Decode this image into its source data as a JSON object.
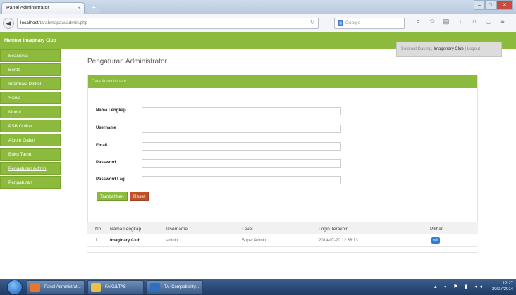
{
  "browser": {
    "tab_title": "Panel Administrator",
    "tab_close": "×",
    "new_tab": "+",
    "url_host": "localhost",
    "url_path": "/tarahmapaw/admin.php",
    "search_placeholder": "Google",
    "window_controls": [
      "–",
      "□",
      "✕"
    ]
  },
  "site": {
    "title": "Member Imaginary Club",
    "welcome_prefix": "Selamat Datang,",
    "welcome_user": "Imagenary Club",
    "logout": "| Logout"
  },
  "sidebar": {
    "items": [
      {
        "label": "Beasiswa"
      },
      {
        "label": "Berita"
      },
      {
        "label": "Informasi Diskel"
      },
      {
        "label": "Siswa"
      },
      {
        "label": "Modul"
      },
      {
        "label": "PSB Online"
      },
      {
        "label": "Album Galeri"
      },
      {
        "label": "Buku Tamu"
      },
      {
        "label": "Pengaturan Admin"
      },
      {
        "label": "Pengaturan"
      }
    ]
  },
  "main": {
    "page_title": "Pengaturan Administrator",
    "panel_title": "Data Administrator",
    "fields": [
      {
        "label": "Nama Lengkap",
        "value": ""
      },
      {
        "label": "Username",
        "value": ""
      },
      {
        "label": "Email",
        "value": ""
      },
      {
        "label": "Password",
        "value": ""
      },
      {
        "label": "Password Lagi",
        "value": ""
      }
    ],
    "add_button": "Tambahkan",
    "reset_button": "Reset",
    "table": {
      "headers": [
        "No",
        "Nama Lengkap",
        "Username",
        "Level",
        "Login Terakhir",
        "Pilihan"
      ],
      "rows": [
        {
          "no": "1",
          "nama": "Imaginary Club",
          "username": "admin",
          "level": "Super Admin",
          "login": "2014-07-20 12:36:13",
          "action": "edit"
        }
      ]
    }
  },
  "taskbar": {
    "items": [
      "Panel Administrat...",
      "FAKULTAS",
      "TA [Compatibility..."
    ],
    "time": "12:27",
    "date": "20/07/2014"
  },
  "colors": {
    "accent_green": "#8cba3c",
    "reset_red": "#c0522a",
    "edit_blue": "#2d7fd6"
  }
}
